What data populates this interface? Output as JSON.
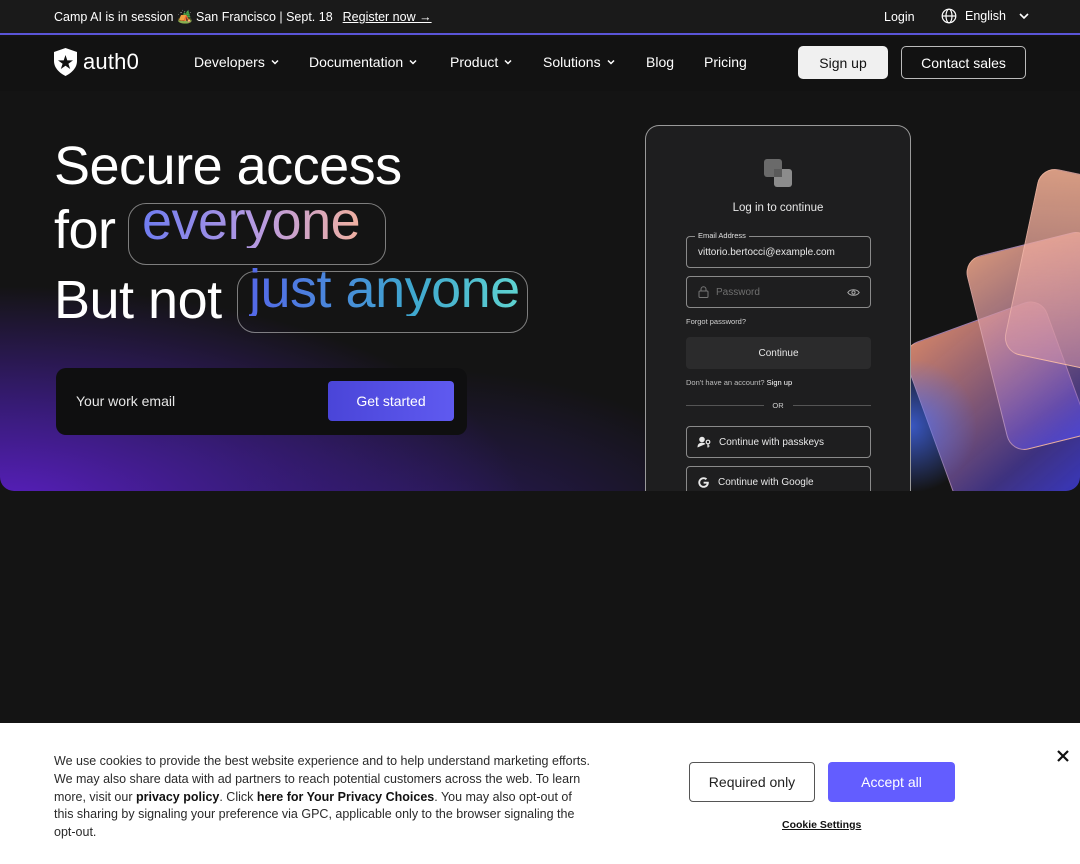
{
  "announcement": {
    "text": "Camp AI is in session 🏕️ San Francisco | Sept. 18",
    "link": "Register now →"
  },
  "topbar": {
    "login": "Login",
    "language": "English"
  },
  "nav": {
    "logo": "auth0",
    "items": [
      {
        "label": "Developers",
        "dropdown": true
      },
      {
        "label": "Documentation",
        "dropdown": true
      },
      {
        "label": "Product",
        "dropdown": true
      },
      {
        "label": "Solutions",
        "dropdown": true
      },
      {
        "label": "Blog",
        "dropdown": false
      },
      {
        "label": "Pricing",
        "dropdown": false
      }
    ],
    "signup": "Sign up",
    "contact": "Contact sales"
  },
  "hero": {
    "line1": "Secure access",
    "line2_prefix": "for",
    "line2_highlight": "everyone",
    "line3_prefix": "But not",
    "line3_highlight": "just anyone",
    "email_placeholder": "Your work email",
    "cta": "Get started"
  },
  "login_mock": {
    "title": "Log in to continue",
    "email_label": "Email Address",
    "email_value": "vittorio.bertocci@example.com",
    "password_placeholder": "Password",
    "forgot": "Forgot password?",
    "continue": "Continue",
    "no_account": "Don't have an account?",
    "signup_link": "Sign up",
    "or": "OR",
    "passkeys": "Continue with passkeys",
    "google": "Continue with Google"
  },
  "cookie": {
    "text_1": "We use cookies to provide the best website experience and to help understand marketing efforts. We may also share data with ad partners to reach potential customers across the web. To learn more, visit our ",
    "privacy_link": "privacy policy",
    "text_2": ". Click ",
    "choices_link": "here for Your Privacy Choices",
    "text_3": ". You may also opt-out of this sharing by signaling your preference via GPC, applicable only to the browser signaling the opt-out.",
    "required_only": "Required only",
    "accept_all": "Accept all",
    "settings": "Cookie Settings"
  },
  "colors": {
    "accent": "#635dff",
    "cta": "#4f4ae0",
    "background": "#141414"
  }
}
